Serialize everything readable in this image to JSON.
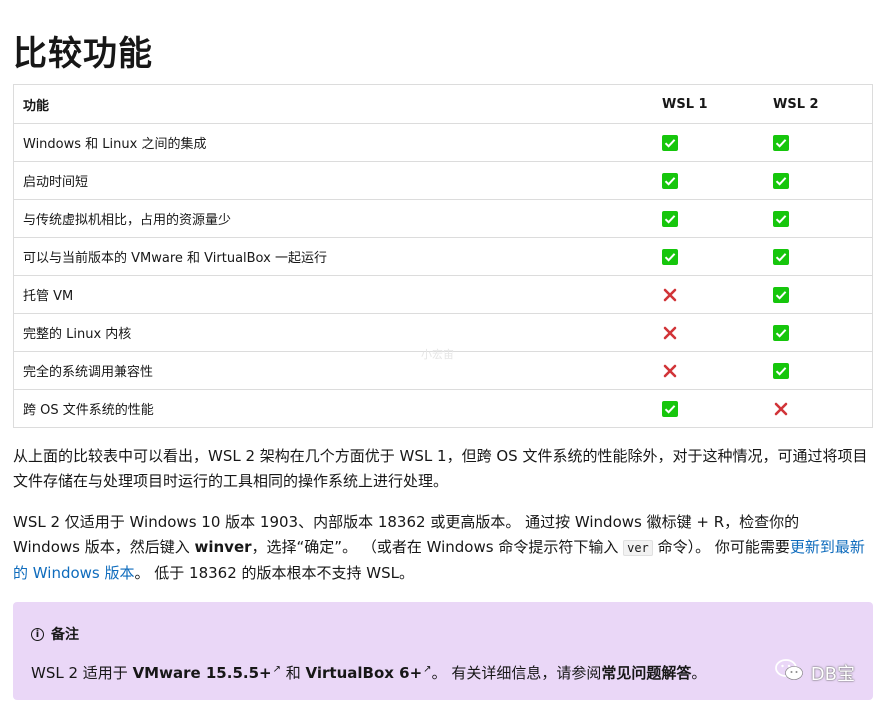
{
  "title": "比较功能",
  "table": {
    "headers": [
      "功能",
      "WSL 1",
      "WSL 2"
    ],
    "rows": [
      {
        "feature": "Windows 和 Linux 之间的集成",
        "wsl1": "yes",
        "wsl2": "yes"
      },
      {
        "feature": "启动时间短",
        "wsl1": "yes",
        "wsl2": "yes"
      },
      {
        "feature": "与传统虚拟机相比，占用的资源量少",
        "wsl1": "yes",
        "wsl2": "yes"
      },
      {
        "feature": "可以与当前版本的 VMware 和 VirtualBox 一起运行",
        "wsl1": "yes",
        "wsl2": "yes"
      },
      {
        "feature": "托管 VM",
        "wsl1": "no",
        "wsl2": "yes"
      },
      {
        "feature": "完整的 Linux 内核",
        "wsl1": "no",
        "wsl2": "yes"
      },
      {
        "feature": "完全的系统调用兼容性",
        "wsl1": "no",
        "wsl2": "yes"
      },
      {
        "feature": "跨 OS 文件系统的性能",
        "wsl1": "yes",
        "wsl2": "no"
      }
    ]
  },
  "para1": "从上面的比较表中可以看出，WSL 2 架构在几个方面优于 WSL 1，但跨 OS 文件系统的性能除外，对于这种情况，可通过将项目文件存储在与处理项目时运行的工具相同的操作系统上进行处理。",
  "para2": {
    "t1": "WSL 2 仅适用于 Windows 10 版本 1903、内部版本 18362 或更高版本。 通过按 Windows 徽标键 + R，检查你的 Windows 版本，然后键入 ",
    "bold": "winver",
    "t2": "，选择“确定”。 （或者在 Windows 命令提示符下输入 ",
    "code": "ver",
    "t3": " 命令）。 你可能需要",
    "link": "更新到最新的 Windows 版本",
    "t4": "。 低于 18362 的版本根本不支持 WSL。"
  },
  "note": {
    "heading": "备注",
    "t1": "WSL 2 适用于 ",
    "link1": "VMware 15.5.5+",
    "t2": " 和 ",
    "link2": "VirtualBox 6+",
    "t3": "。 有关详细信息，请参阅",
    "link3": "常见问题解答",
    "t4": "。"
  },
  "watermark": {
    "text": "DB宝",
    "icon": "wechat-icon"
  },
  "center_watermark": "小宏宙",
  "colors": {
    "check_green": "#16c60c",
    "cross_red": "#d13438",
    "note_bg": "#ead7f7",
    "link": "#0f6cbd"
  }
}
